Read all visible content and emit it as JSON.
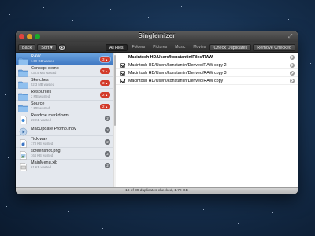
{
  "window": {
    "title": "Singlemizer"
  },
  "toolbar": {
    "back_label": "Back",
    "sort_label": "Sort ▾",
    "filters": [
      "All Files",
      "Folders",
      "Pictures",
      "Music",
      "Movies",
      "Texts"
    ],
    "active_filter": "All Files",
    "check_duplicates_label": "Check Duplicates",
    "remove_checked_label": "Remove Checked"
  },
  "sidebar": {
    "items": [
      {
        "name": "RAW",
        "sub": "1.59 GB wasted",
        "icon": "folder-icon",
        "badge": "3",
        "badge_style": "alert",
        "selected": true
      },
      {
        "name": "Concept demo",
        "sub": "438.5 MB wasted",
        "icon": "folder-icon",
        "badge": "2",
        "badge_style": "alert",
        "selected": false
      },
      {
        "name": "Sketches",
        "sub": "52.3 MB wasted",
        "icon": "folder-icon",
        "badge": "3",
        "badge_style": "alert",
        "selected": false
      },
      {
        "name": "Resources",
        "sub": "2 MB wasted",
        "icon": "folder-icon",
        "badge": "2",
        "badge_style": "alert",
        "selected": false
      },
      {
        "name": "Source",
        "sub": "1 MB wasted",
        "icon": "folder-icon",
        "badge": "2",
        "badge_style": "alert",
        "selected": false
      },
      {
        "name": "Readme.markdown",
        "sub": "29 KB wasted",
        "icon": "document-icon",
        "badge": "2",
        "badge_style": "gray",
        "selected": false
      },
      {
        "name": "MacUpdate Promo.mov",
        "sub": "",
        "icon": "movie-icon",
        "badge": "2",
        "badge_style": "gray",
        "selected": false
      },
      {
        "name": "Tick.wav",
        "sub": "173 KB wasted",
        "icon": "audio-icon",
        "badge": "2",
        "badge_style": "gray",
        "selected": false
      },
      {
        "name": "screenshot.png",
        "sub": "164 KB wasted",
        "icon": "image-icon",
        "badge": "2",
        "badge_style": "gray",
        "selected": false
      },
      {
        "name": "MainMenu.xib",
        "sub": "61 KB wasted",
        "icon": "xib-icon",
        "badge": "2",
        "badge_style": "gray",
        "selected": false
      }
    ]
  },
  "main": {
    "rows": [
      {
        "path": "Macintosh HD/Users/konstantin/Files/RAW",
        "checked": false,
        "header": true
      },
      {
        "path": "Macintosh HD/Users/konstantin/Derived/RAW copy 2",
        "checked": true,
        "header": false
      },
      {
        "path": "Macintosh HD/Users/konstantin/Derived/RAW copy 3",
        "checked": true,
        "header": false
      },
      {
        "path": "Macintosh HD/Users/konstantin/Derived/RAW copy",
        "checked": true,
        "header": false
      }
    ]
  },
  "status": {
    "text": "18 of 39 duplicates checked, 1.72 GB"
  },
  "colors": {
    "selection": "#4a84cc",
    "badge_alert": "#d23b2b",
    "badge_gray": "#6d7177"
  }
}
